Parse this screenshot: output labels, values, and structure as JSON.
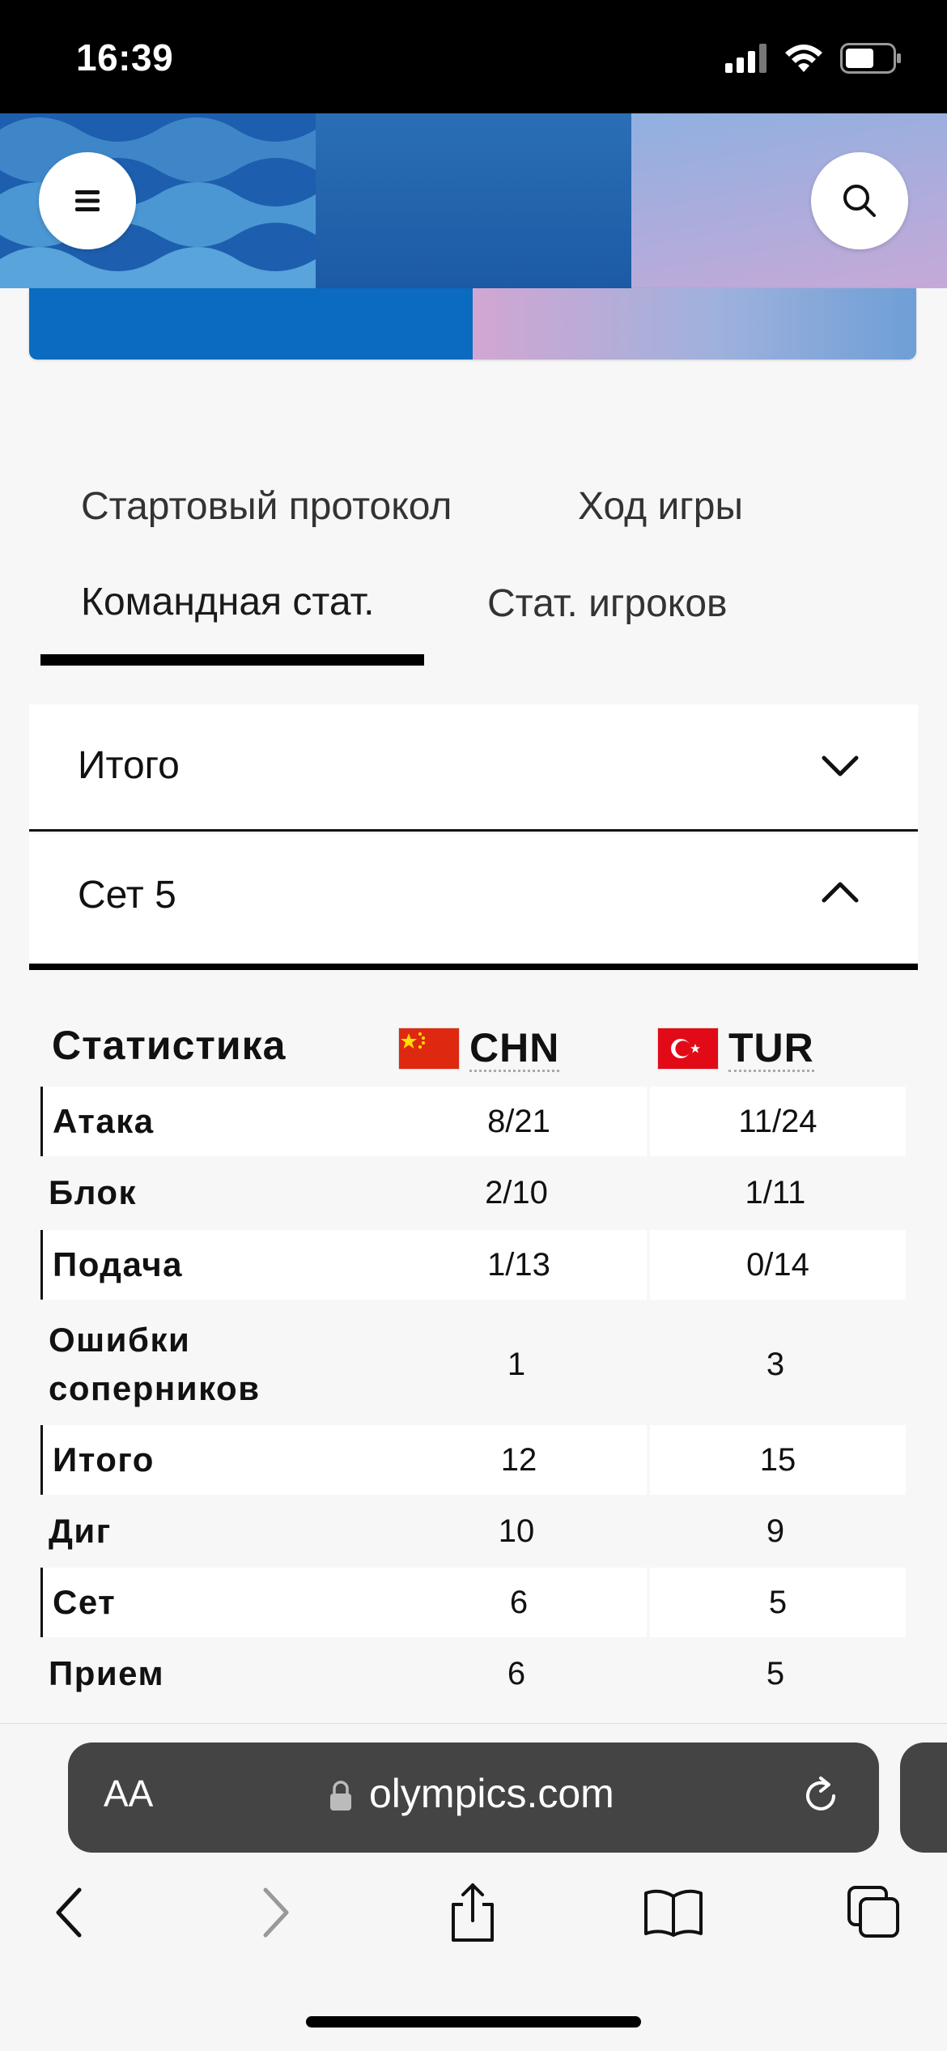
{
  "status_bar": {
    "time": "16:39"
  },
  "tabs": [
    {
      "label": "Стартовый протокол",
      "active": false
    },
    {
      "label": "Ход игры",
      "active": false
    },
    {
      "label": "Командная стат.",
      "active": true
    },
    {
      "label": "Стат. игроков",
      "active": false
    }
  ],
  "accordions": [
    {
      "title": "Итого",
      "expanded": false
    },
    {
      "title": "Сет 5",
      "expanded": true
    }
  ],
  "stats": {
    "header": "Статистика",
    "teams": [
      {
        "code": "CHN",
        "flag": "china-flag-icon"
      },
      {
        "code": "TUR",
        "flag": "turkey-flag-icon"
      }
    ],
    "rows": [
      {
        "label": "Атака",
        "chn": "8/21",
        "tur": "11/24"
      },
      {
        "label": "Блок",
        "chn": "2/10",
        "tur": "1/11"
      },
      {
        "label": "Подача",
        "chn": "1/13",
        "tur": "0/14"
      },
      {
        "label": "Ошибки соперников",
        "chn": "1",
        "tur": "3"
      },
      {
        "label": "Итого",
        "chn": "12",
        "tur": "15"
      },
      {
        "label": "Диг",
        "chn": "10",
        "tur": "9"
      },
      {
        "label": "Сет",
        "chn": "6",
        "tur": "5"
      },
      {
        "label": "Прием",
        "chn": "6",
        "tur": "5"
      }
    ]
  },
  "browser": {
    "aa_label": "AA",
    "url": "olympics.com"
  },
  "colors": {
    "banner_blue": "#1e66b4",
    "banner_pink": "#c6a9d8",
    "url_bar": "#444444"
  }
}
